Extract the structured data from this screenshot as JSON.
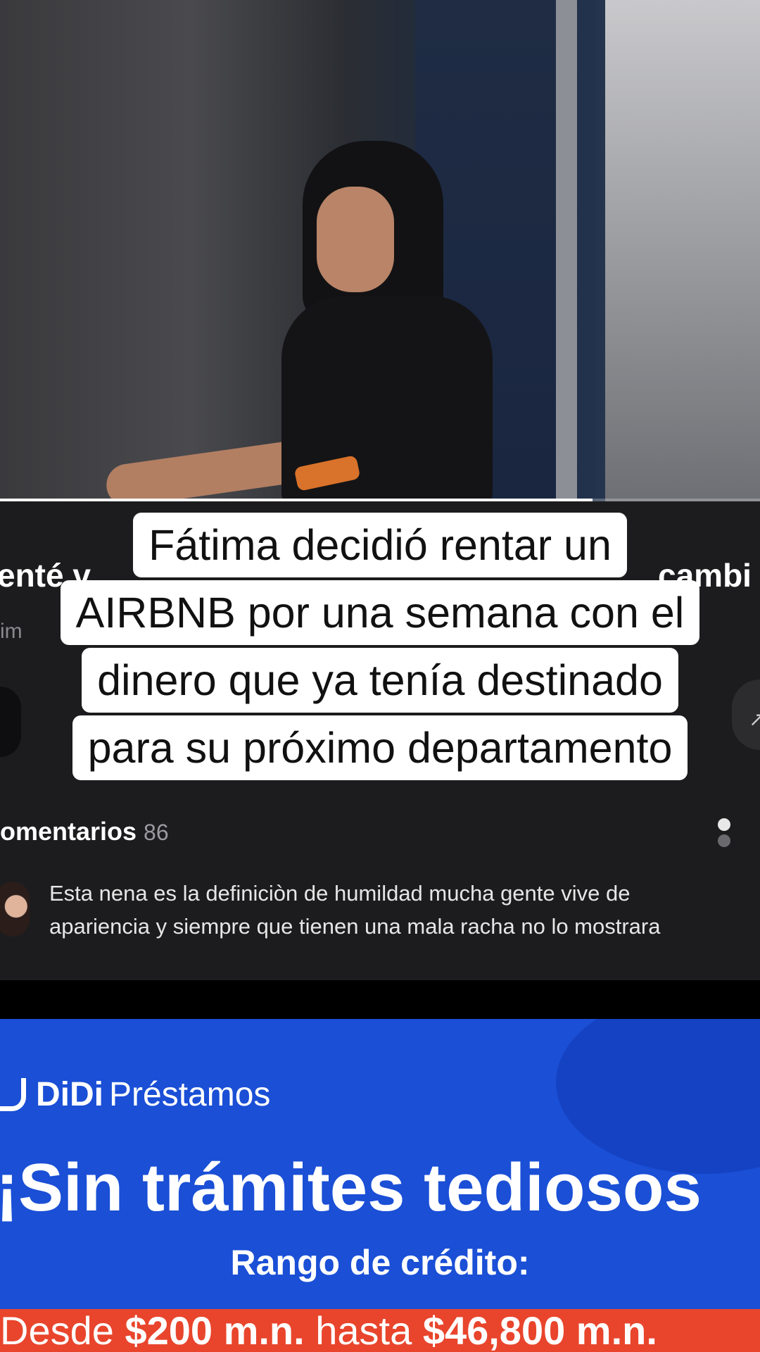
{
  "video": {
    "progress_fraction": 0.78
  },
  "background_ui": {
    "left_title_fragment": "enté v",
    "right_title_fragment": "cambi",
    "left_sub_fragment": "im"
  },
  "caption": {
    "lines": [
      "Fátima decidió rentar un",
      "AIRBNB por una semana con el",
      "dinero que ya tenía destinado",
      "para su próximo departamento"
    ]
  },
  "comments": {
    "header": "omentarios",
    "count": "86",
    "first_comment": {
      "line1": "Esta nena es la definiciòn de humildad mucha gente vive de",
      "line2": "apariencia y siempre que tienen una mala racha no lo mostrara"
    }
  },
  "ad": {
    "brand": "DiDi",
    "product": "Préstamos",
    "headline": "¡Sin trámites tediosos",
    "range_label": "Rango de crédito:",
    "range_from_prefix": "Desde ",
    "range_from": "$200 m.n.",
    "range_mid": " hasta ",
    "range_to": "$46,800 m.n."
  },
  "colors": {
    "ad_blue": "#1a4fd6",
    "ad_red": "#e8452c",
    "caption_bg": "#ffffff",
    "dark_panel": "#1c1c1e"
  }
}
